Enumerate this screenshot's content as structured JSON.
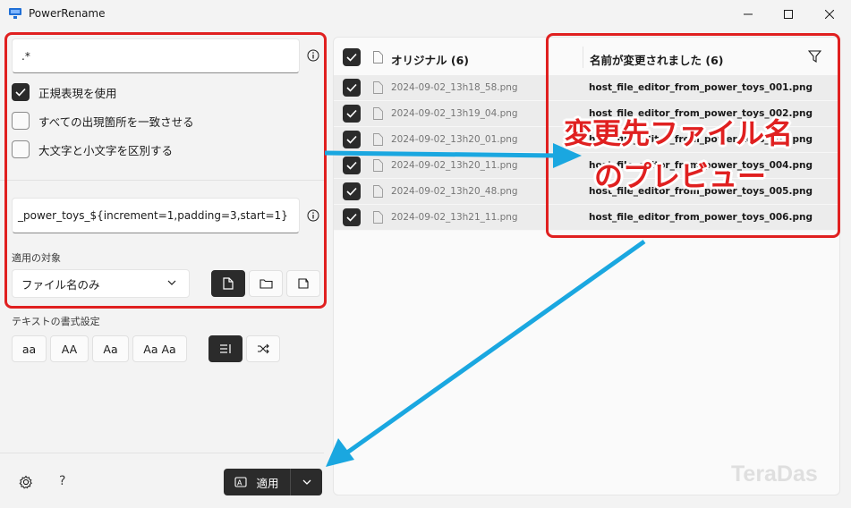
{
  "window": {
    "title": "PowerRename"
  },
  "search": {
    "value": ".*"
  },
  "options": [
    {
      "label": "正規表現を使用",
      "checked": true
    },
    {
      "label": "すべての出現箇所を一致させる",
      "checked": false
    },
    {
      "label": "大文字と小文字を区別する",
      "checked": false
    }
  ],
  "replace": {
    "value": "_power_toys_${increment=1,padding=3,start=1}"
  },
  "apply_to": {
    "label": "適用の対象",
    "selected": "ファイル名のみ"
  },
  "text_format": {
    "label": "テキストの書式設定",
    "buttons": [
      "aa",
      "AA",
      "Aa",
      "Aa Aa"
    ]
  },
  "preview": {
    "original_header": "オリジナル (6)",
    "renamed_header": "名前が変更されました (6)",
    "rows": [
      {
        "original": "2024-09-02_13h18_58.png",
        "renamed": "host_file_editor_from_power_toys_001.png"
      },
      {
        "original": "2024-09-02_13h19_04.png",
        "renamed": "host_file_editor_from_power_toys_002.png"
      },
      {
        "original": "2024-09-02_13h20_01.png",
        "renamed": "host_file_editor_from_power_toys_003.png"
      },
      {
        "original": "2024-09-02_13h20_11.png",
        "renamed": "host_file_editor_from_power_toys_004.png"
      },
      {
        "original": "2024-09-02_13h20_48.png",
        "renamed": "host_file_editor_from_power_toys_005.png"
      },
      {
        "original": "2024-09-02_13h21_11.png",
        "renamed": "host_file_editor_from_power_toys_006.png"
      }
    ]
  },
  "apply_button": {
    "label": "適用"
  },
  "annotation": {
    "line1": "変更先ファイル名",
    "line2": "のプレビュー"
  },
  "watermark": "TeraDas",
  "colors": {
    "highlight": "#e02020",
    "arrow": "#1aa7e0",
    "accent_dark": "#2b2b2b"
  }
}
